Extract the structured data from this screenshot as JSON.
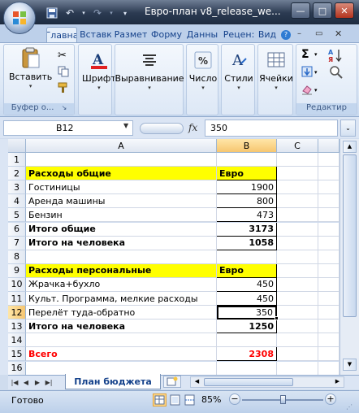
{
  "window": {
    "title": "Евро-план v8_release_we...",
    "minimize_glyph": "—",
    "maximize_glyph": "□",
    "close_glyph": "✕"
  },
  "ribbon_tabs": [
    "Главная",
    "Вставка",
    "Разметка",
    "Формулы",
    "Данные",
    "Рецензирование",
    "Вид"
  ],
  "ribbon_tabs_visible": [
    "Главна",
    "Вставк",
    "Размет",
    "Форму",
    "Данны",
    "Рецен:",
    "Вид"
  ],
  "ribbon": {
    "paste_label": "Вставить",
    "clipboard_group": "Буфер о...",
    "font_label": "Шрифт",
    "align_label": "Выравнивание",
    "number_label": "Число",
    "styles_label": "Стили",
    "cells_label": "Ячейки",
    "editing_group": "Редактир",
    "sigma_glyph": "Σ"
  },
  "formula_bar": {
    "name_box": "B12",
    "fx": "fx",
    "value": "350"
  },
  "columns": [
    "A",
    "B",
    "C"
  ],
  "rows": [
    {
      "n": "1",
      "a": "",
      "b": ""
    },
    {
      "n": "2",
      "a": "Расходы общие",
      "b": "Евро"
    },
    {
      "n": "3",
      "a": "Гостиницы",
      "b": "1900"
    },
    {
      "n": "4",
      "a": "Аренда машины",
      "b": "800"
    },
    {
      "n": "5",
      "a": "Бензин",
      "b": "473"
    },
    {
      "n": "6",
      "a": "Итого общие",
      "b": "3173"
    },
    {
      "n": "7",
      "a": "Итого на человека",
      "b": "1058"
    },
    {
      "n": "8",
      "a": "",
      "b": ""
    },
    {
      "n": "9",
      "a": "Расходы персональные",
      "b": "Евро"
    },
    {
      "n": "10",
      "a": "Жрачка+бухло",
      "b": "450"
    },
    {
      "n": "11",
      "a": "Культ. Программа, мелкие расходы",
      "b": "450"
    },
    {
      "n": "12",
      "a": "Перелёт туда-обратно",
      "b": "350"
    },
    {
      "n": "13",
      "a": "Итого на человека",
      "b": "1250"
    },
    {
      "n": "14",
      "a": "",
      "b": ""
    },
    {
      "n": "15",
      "a": "Всего",
      "b": "2308"
    },
    {
      "n": "16",
      "a": "",
      "b": ""
    }
  ],
  "sheet": {
    "tab_name": "План бюджета"
  },
  "status": {
    "ready": "Готово",
    "zoom": "85%",
    "minus": "−",
    "plus": "+"
  },
  "colors": {
    "accent": "#15428b",
    "highlight": "#ffff00",
    "total_red": "#ff0000"
  }
}
